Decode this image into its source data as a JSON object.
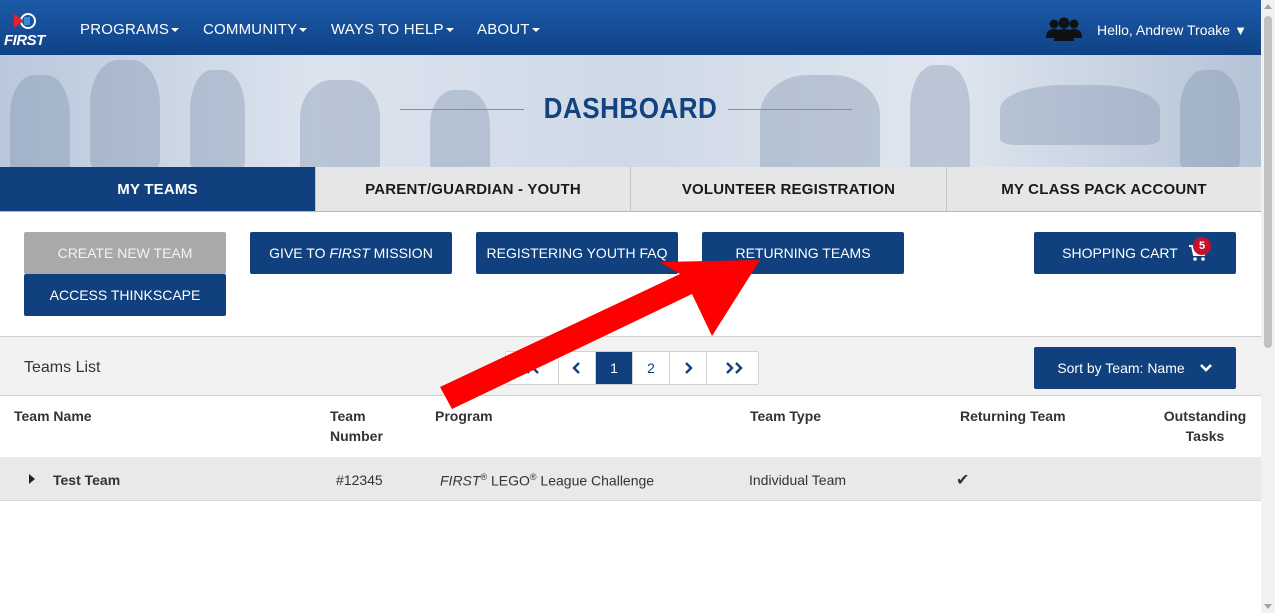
{
  "nav": {
    "logo_text": "FIRST",
    "items": [
      {
        "label": "PROGRAMS"
      },
      {
        "label": "COMMUNITY"
      },
      {
        "label": "WAYS TO HELP"
      },
      {
        "label": "ABOUT"
      }
    ],
    "greeting": "Hello, Andrew Troake",
    "greeting_caret": "▼"
  },
  "hero": {
    "title": "DASHBOARD"
  },
  "tabs": [
    {
      "label": "MY TEAMS",
      "active": true
    },
    {
      "label": "PARENT/GUARDIAN - YOUTH"
    },
    {
      "label": "VOLUNTEER REGISTRATION"
    },
    {
      "label": "MY CLASS PACK ACCOUNT"
    }
  ],
  "actions": {
    "create_new_team": "CREATE NEW TEAM",
    "give_prefix": "GIVE TO ",
    "give_brand": "FIRST",
    "give_suffix": " MISSION",
    "registering_youth_faq": "REGISTERING YOUTH FAQ",
    "returning_teams": "RETURNING TEAMS",
    "shopping_cart": "SHOPPING CART",
    "cart_count": "5",
    "access_thinkscape": "ACCESS THINKSCAPE"
  },
  "list": {
    "title": "Teams List",
    "pager": {
      "current": "1",
      "page2": "2"
    },
    "sort_label": "Sort by Team: Name"
  },
  "table": {
    "headers": {
      "team_name": "Team Name",
      "team_number_1": "Team",
      "team_number_2": "Number",
      "program": "Program",
      "team_type": "Team Type",
      "returning_team": "Returning Team",
      "outstanding_1": "Outstanding",
      "outstanding_2": "Tasks"
    },
    "rows": [
      {
        "team_name": "Test Team",
        "team_number": "#12345",
        "program_brand": "FIRST",
        "program_lego": " LEGO",
        "program_rest": " League Challenge",
        "reg": "®",
        "team_type": "Individual Team",
        "returning_mark": "✔"
      }
    ]
  },
  "colors": {
    "brand_blue": "#10417e",
    "annotation_red": "#ff0000",
    "badge_red": "#c8102e"
  }
}
